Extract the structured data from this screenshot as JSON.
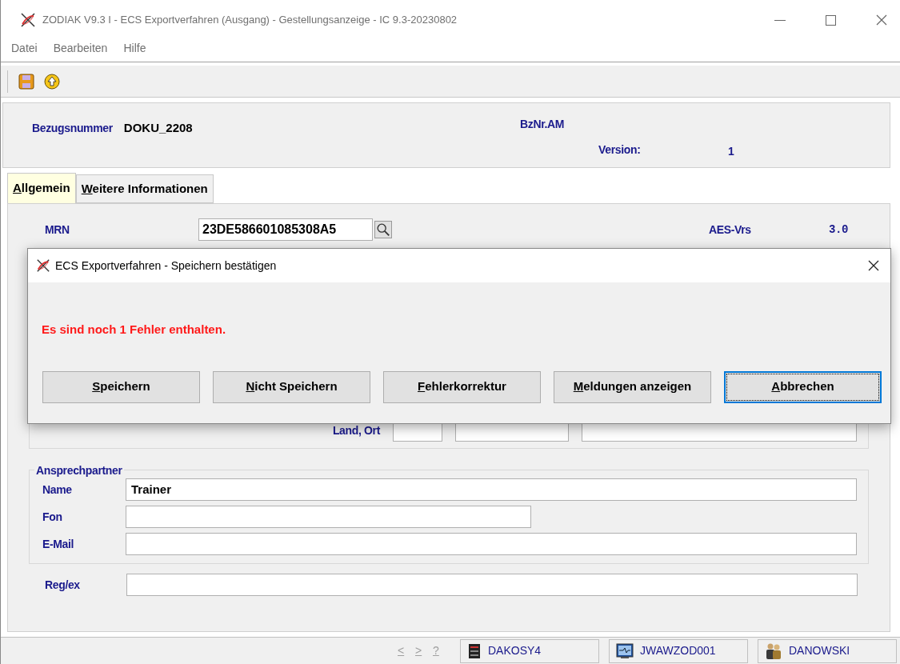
{
  "window": {
    "title": "ZODIAK V9.3 I - ECS Exportverfahren (Ausgang) - Gestellungsanzeige - IC 9.3-20230802"
  },
  "menu": [
    "Datei",
    "Bearbeiten",
    "Hilfe"
  ],
  "header": {
    "bezugsnummer_label": "Bezugsnummer",
    "bezugsnummer": "DOKU_2208",
    "bznr_am_label": "BzNr.AM",
    "version_label": "Version:",
    "version": "1"
  },
  "tabs": [
    {
      "label": "Allgemein",
      "selected": true
    },
    {
      "label": "Weitere Informationen",
      "selected": false
    }
  ],
  "mrn": {
    "label": "MRN",
    "value": "23DE586601085308A5"
  },
  "aes": {
    "label": "AES-Vrs",
    "value": "3.0"
  },
  "address": {
    "label": "Land, Ort"
  },
  "contact": {
    "title": "Ansprechpartner",
    "fields": [
      {
        "label": "Name",
        "value": "Trainer",
        "kind": "long"
      },
      {
        "label": "Fon",
        "kind": "short"
      },
      {
        "label": "E-Mail",
        "kind": "long"
      }
    ]
  },
  "regex": {
    "label": "Reg/ex"
  },
  "dialog": {
    "title": "ECS Exportverfahren - Speichern bestätigen",
    "message": "Es sind noch 1 Fehler enthalten.",
    "buttons": [
      {
        "label": "Speichern",
        "selected": false
      },
      {
        "label": "Nicht Speichern",
        "selected": false
      },
      {
        "label": "Fehlerkorrektur",
        "selected": false
      },
      {
        "label": "Meldungen anzeigen",
        "selected": false
      },
      {
        "label": "Abbrechen",
        "selected": true
      }
    ]
  },
  "status_bar": {
    "nav": [
      {
        "label": "<",
        "disabled": true
      },
      {
        "label": ">",
        "disabled": true
      },
      {
        "label": "?",
        "disabled": true
      }
    ],
    "segments": [
      {
        "kind": "server",
        "label": "DAKOSY4"
      },
      {
        "kind": "terminal",
        "label": "JWAWZOD001"
      },
      {
        "kind": "users",
        "label": "DANOWSKI"
      }
    ]
  }
}
